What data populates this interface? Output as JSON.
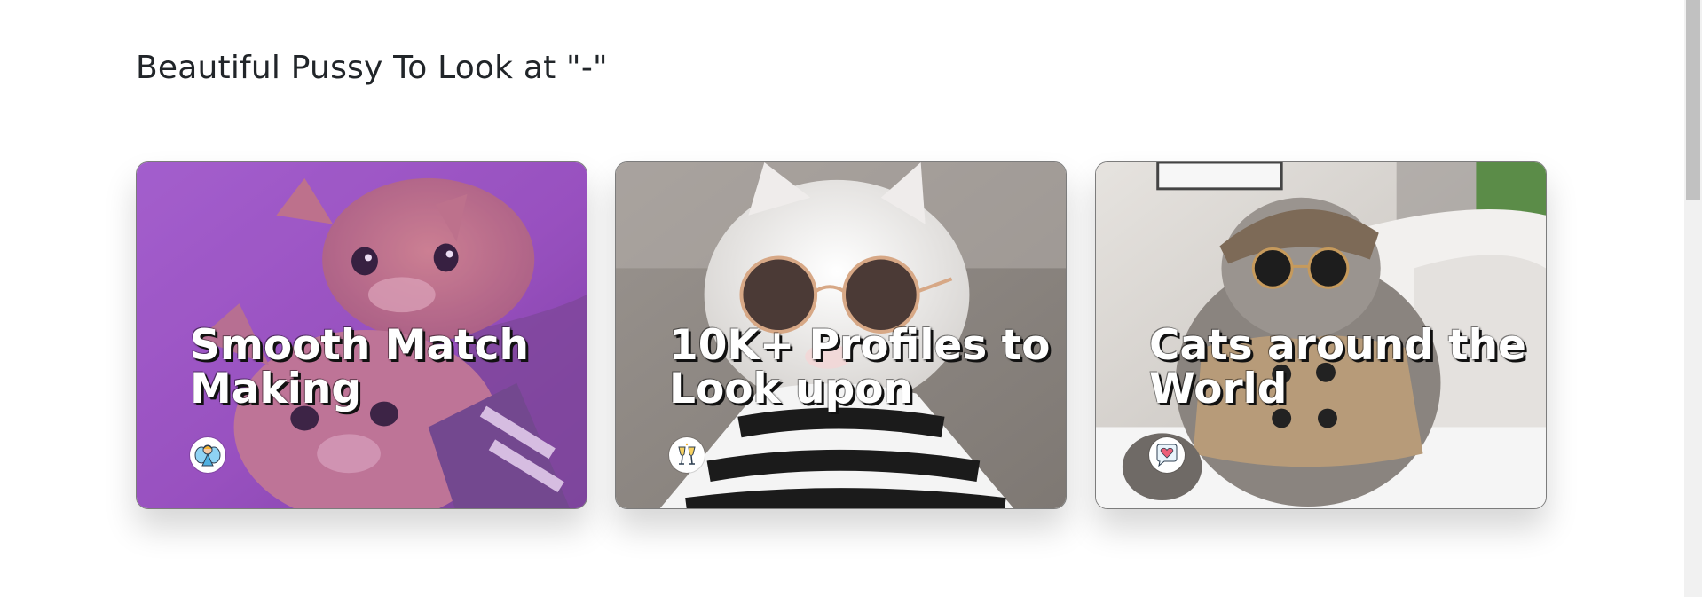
{
  "section": {
    "title": "Beautiful Pussy To Look at \"-\""
  },
  "cards": [
    {
      "title": "Smooth Match Making",
      "icon": "fairy-icon",
      "accent": "#9b59c5"
    },
    {
      "title": "10K+ Profiles to Look upon",
      "icon": "champagne-toast-icon",
      "accent": "#8f8a85"
    },
    {
      "title": "Cats around the World",
      "icon": "heart-chat-icon",
      "accent": "#d8d3ce"
    }
  ]
}
